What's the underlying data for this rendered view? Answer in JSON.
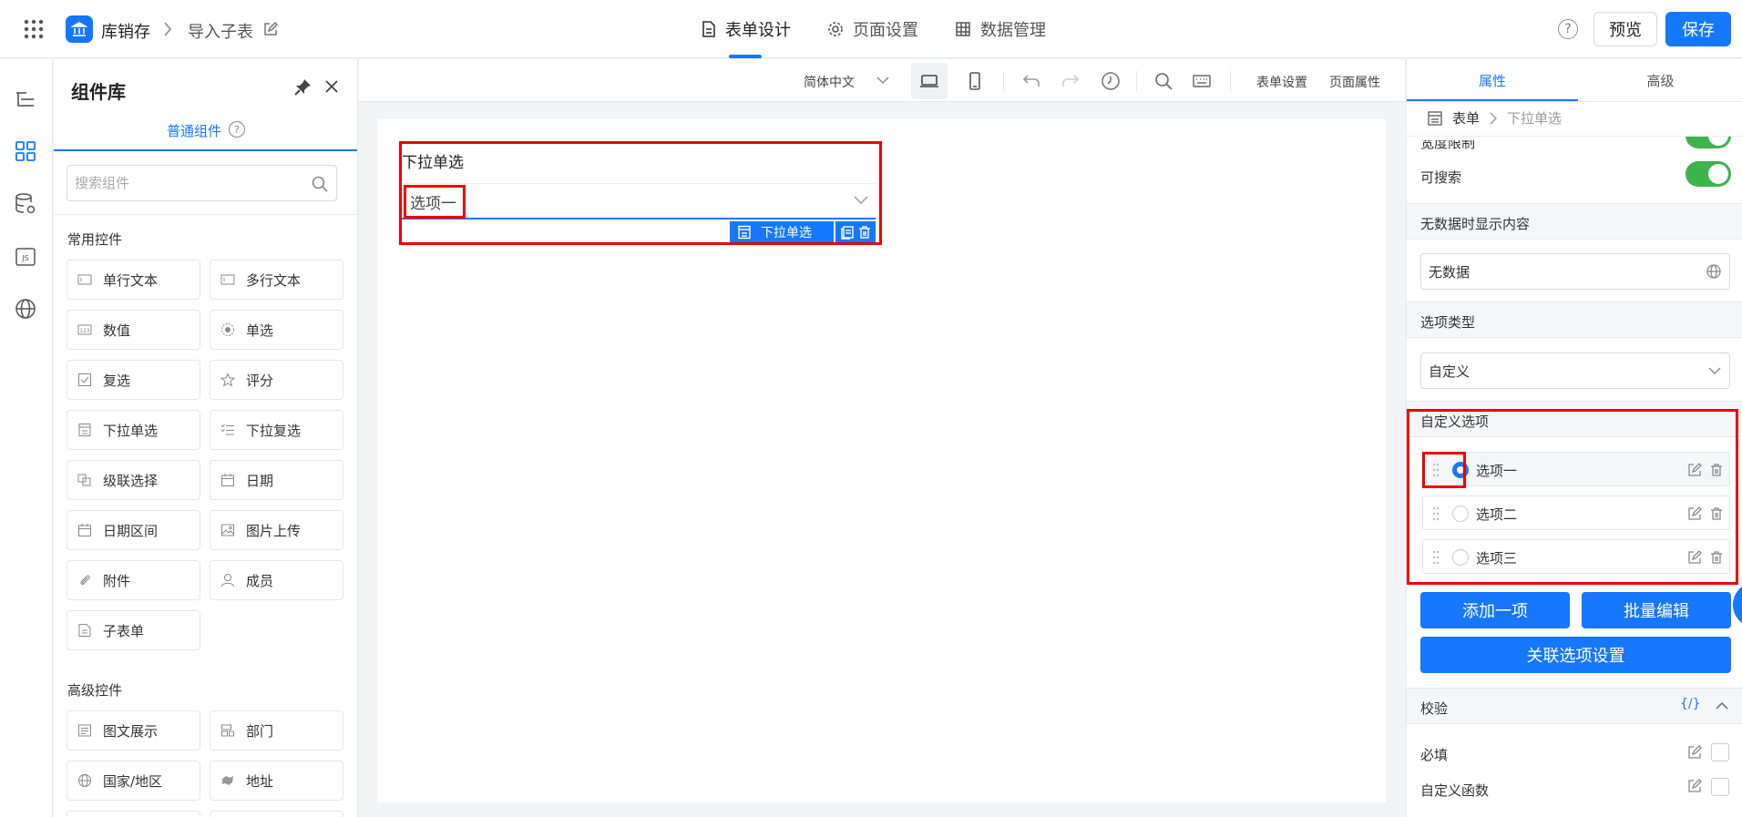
{
  "header": {
    "app_name": "库销存",
    "current_page": "导入子表",
    "tabs": [
      {
        "label": "表单设计"
      },
      {
        "label": "页面设置"
      },
      {
        "label": "数据管理"
      }
    ],
    "help_label": "?",
    "preview_label": "预览",
    "save_label": "保存"
  },
  "library": {
    "title": "组件库",
    "tab_label": "普通组件",
    "help_label": "?",
    "search_placeholder": "搜索组件",
    "common_title": "常用控件",
    "common": [
      {
        "label": "单行文本",
        "icon": "single-line-text-icon"
      },
      {
        "label": "多行文本",
        "icon": "multi-line-text-icon"
      },
      {
        "label": "数值",
        "icon": "number-icon"
      },
      {
        "label": "单选",
        "icon": "radio-icon"
      },
      {
        "label": "复选",
        "icon": "checkbox-icon"
      },
      {
        "label": "评分",
        "icon": "star-icon"
      },
      {
        "label": "下拉单选",
        "icon": "dropdown-single-icon"
      },
      {
        "label": "下拉复选",
        "icon": "dropdown-multi-icon"
      },
      {
        "label": "级联选择",
        "icon": "cascade-icon"
      },
      {
        "label": "日期",
        "icon": "calendar-icon"
      },
      {
        "label": "日期区间",
        "icon": "date-range-icon"
      },
      {
        "label": "图片上传",
        "icon": "image-icon"
      },
      {
        "label": "附件",
        "icon": "paperclip-icon"
      },
      {
        "label": "成员",
        "icon": "user-icon"
      },
      {
        "label": "子表单",
        "icon": "subform-icon"
      }
    ],
    "advanced_title": "高级控件",
    "advanced": [
      {
        "label": "图文展示",
        "icon": "rich-text-icon"
      },
      {
        "label": "部门",
        "icon": "department-icon"
      },
      {
        "label": "国家/地区",
        "icon": "globe-icon"
      },
      {
        "label": "地址",
        "icon": "map-icon"
      }
    ]
  },
  "toolbar": {
    "language": "简体中文",
    "form_settings": "表单设置",
    "page_props": "页面属性"
  },
  "canvas": {
    "field_label": "下拉单选",
    "field_value": "选项一",
    "field_tag": "下拉单选"
  },
  "props": {
    "tab_props": "属性",
    "tab_advanced": "高级",
    "bread_root": "表单",
    "bread_current": "下拉单选",
    "width_limit": "宽度限制",
    "searchable": "可搜索",
    "empty_title": "无数据时显示内容",
    "empty_value": "无数据",
    "option_type_title": "选项类型",
    "option_type_value": "自定义",
    "custom_options_title": "自定义选项",
    "options": [
      {
        "label": "选项一",
        "selected": true
      },
      {
        "label": "选项二",
        "selected": false
      },
      {
        "label": "选项三",
        "selected": false
      }
    ],
    "add_item": "添加一项",
    "batch_edit": "批量编辑",
    "linked_settings": "关联选项设置",
    "validation_title": "校验",
    "validation_code": "{/}",
    "required_label": "必填",
    "custom_func_label": "自定义函数"
  },
  "colors": {
    "accent": "#1677ff",
    "toggle_on": "#3bb44a",
    "highlight": "#ee0000"
  }
}
